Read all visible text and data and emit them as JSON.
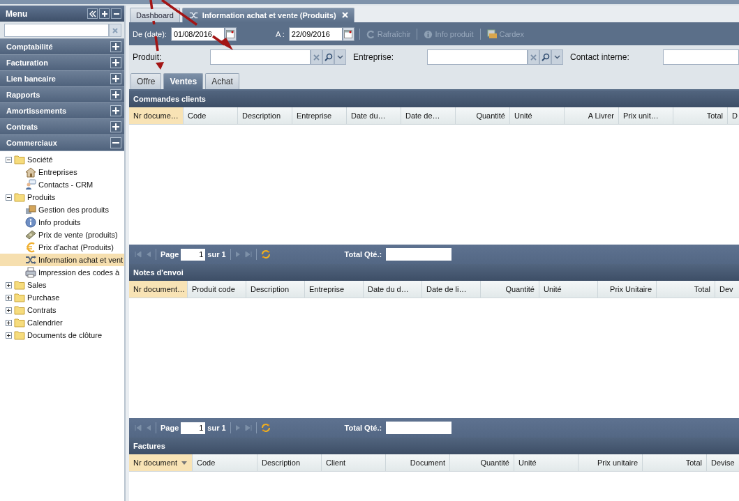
{
  "menu": {
    "title": "Menu",
    "accordion": [
      {
        "label": "Comptabilité",
        "expanded": false
      },
      {
        "label": "Facturation",
        "expanded": false
      },
      {
        "label": "Lien bancaire",
        "expanded": false
      },
      {
        "label": "Rapports",
        "expanded": false
      },
      {
        "label": "Amortissements",
        "expanded": false
      },
      {
        "label": "Contrats",
        "expanded": false
      },
      {
        "label": "Commerciaux",
        "expanded": true
      }
    ],
    "tree": [
      {
        "label": "Société",
        "expanded": true,
        "selected": false,
        "children": [
          {
            "label": "Entreprises",
            "selected": false
          },
          {
            "label": "Contacts - CRM",
            "selected": false
          }
        ]
      },
      {
        "label": "Produits",
        "expanded": true,
        "selected": false,
        "children": [
          {
            "label": "Gestion des produits",
            "selected": false
          },
          {
            "label": "Info produits",
            "selected": false
          },
          {
            "label": "Prix de vente (produits)",
            "selected": false
          },
          {
            "label": "Prix d'achat (Produits)",
            "selected": false
          },
          {
            "label": "Information achat et vent",
            "selected": true
          },
          {
            "label": "Impression des codes à",
            "selected": false
          }
        ]
      },
      {
        "label": "Sales",
        "expanded": false,
        "selected": false
      },
      {
        "label": "Purchase",
        "expanded": false,
        "selected": false
      },
      {
        "label": "Contrats",
        "expanded": false,
        "selected": false
      },
      {
        "label": "Calendrier",
        "expanded": false,
        "selected": false
      },
      {
        "label": "Documents de clôture",
        "expanded": false,
        "selected": false
      }
    ]
  },
  "tabs": [
    {
      "label": "Dashboard",
      "selected": false,
      "closable": false
    },
    {
      "label": "Information achat et vente (Produits)",
      "selected": true,
      "closable": true
    }
  ],
  "toolbar": {
    "from_label": "De (date):",
    "from_value": "01/08/2016",
    "to_label": "A :",
    "to_value": "22/09/2016",
    "actions": [
      {
        "label": "Rafraîchir",
        "disabled": true
      },
      {
        "label": "Info produit",
        "disabled": true
      },
      {
        "label": "Cardex",
        "disabled": true
      }
    ]
  },
  "filters": [
    {
      "label": "Produit:",
      "kind": "combo"
    },
    {
      "label": "Entreprise:",
      "kind": "combo"
    },
    {
      "label": "Contact interne:",
      "kind": "text"
    }
  ],
  "sub_tabs": [
    {
      "label": "Offre",
      "selected": false
    },
    {
      "label": "Ventes",
      "selected": true
    },
    {
      "label": "Achat",
      "selected": false
    }
  ],
  "sections": [
    {
      "title": "Commandes clients",
      "columns": [
        {
          "label": "Nr docume…",
          "sorted": true,
          "kind": "text"
        },
        {
          "label": "Code",
          "sorted": false,
          "kind": "text"
        },
        {
          "label": "Description",
          "sorted": false,
          "kind": "text"
        },
        {
          "label": "Entreprise",
          "sorted": false,
          "kind": "text"
        },
        {
          "label": "Date du…",
          "sorted": false,
          "kind": "text"
        },
        {
          "label": "Date de…",
          "sorted": false,
          "kind": "text"
        },
        {
          "label": "Quantité",
          "sorted": false,
          "kind": "number"
        },
        {
          "label": "Unité",
          "sorted": false,
          "kind": "text"
        },
        {
          "label": "A Livrer",
          "sorted": false,
          "kind": "number"
        },
        {
          "label": "Prix unit…",
          "sorted": false,
          "kind": "text"
        },
        {
          "label": "Total",
          "sorted": false,
          "kind": "number"
        },
        {
          "label": "D",
          "sorted": false,
          "kind": "text"
        }
      ],
      "pager": {
        "page_label": "Page",
        "page": "1",
        "of": "sur 1",
        "total_label": "Total Qté.:"
      }
    },
    {
      "title": "Notes d'envoi",
      "columns": [
        {
          "label": "Nr document…",
          "sorted": true,
          "kind": "text"
        },
        {
          "label": "Produit code",
          "sorted": false,
          "kind": "text"
        },
        {
          "label": "Description",
          "sorted": false,
          "kind": "text"
        },
        {
          "label": "Entreprise",
          "sorted": false,
          "kind": "text"
        },
        {
          "label": "Date du d…",
          "sorted": false,
          "kind": "text"
        },
        {
          "label": "Date de li…",
          "sorted": false,
          "kind": "text"
        },
        {
          "label": "Quantité",
          "sorted": false,
          "kind": "number"
        },
        {
          "label": "Unité",
          "sorted": false,
          "kind": "text"
        },
        {
          "label": "Prix Unitaire",
          "sorted": false,
          "kind": "number"
        },
        {
          "label": "Total",
          "sorted": false,
          "kind": "number"
        },
        {
          "label": "Dev",
          "sorted": false,
          "kind": "text"
        }
      ],
      "pager": {
        "page_label": "Page",
        "page": "1",
        "of": "sur 1",
        "total_label": "Total Qté.:"
      }
    },
    {
      "title": "Factures",
      "columns": [
        {
          "label": "Nr document",
          "sorted": true,
          "sort_arrow": true,
          "kind": "text"
        },
        {
          "label": "Code",
          "sorted": false,
          "kind": "text"
        },
        {
          "label": "Description",
          "sorted": false,
          "kind": "text"
        },
        {
          "label": "Client",
          "sorted": false,
          "kind": "text"
        },
        {
          "label": "Document",
          "sorted": false,
          "kind": "number"
        },
        {
          "label": "Quantité",
          "sorted": false,
          "kind": "number"
        },
        {
          "label": "Unité",
          "sorted": false,
          "kind": "text"
        },
        {
          "label": "Prix unitaire",
          "sorted": false,
          "kind": "number"
        },
        {
          "label": "Total",
          "sorted": false,
          "kind": "number"
        },
        {
          "label": "Devise",
          "sorted": false,
          "kind": "text"
        }
      ]
    }
  ]
}
